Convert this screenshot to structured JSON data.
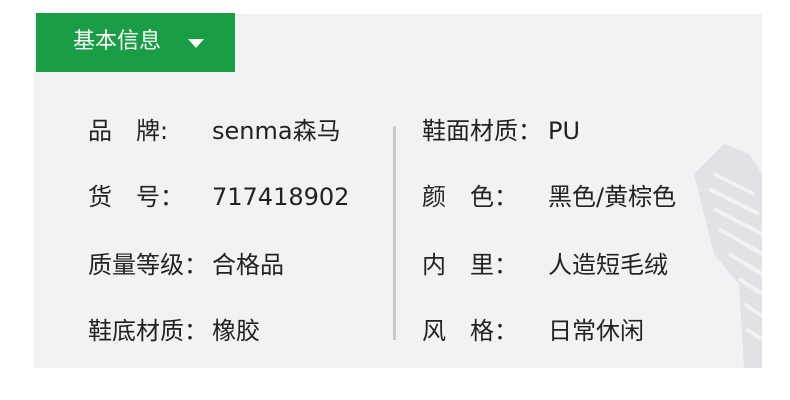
{
  "tab": {
    "label": "基本信息",
    "icon": "caret-down-icon"
  },
  "left": [
    {
      "key": "品　牌:",
      "value": "senma森马"
    },
    {
      "key": "货　号：",
      "value": "717418902"
    },
    {
      "key": "质量等级：",
      "value": "合格品"
    },
    {
      "key": "鞋底材质：",
      "value": "橡胶"
    }
  ],
  "right": [
    {
      "key": "鞋面材质：",
      "value": "PU"
    },
    {
      "key": "颜　色：",
      "value": "黑色/黄棕色"
    },
    {
      "key": "内　里：",
      "value": "人造短毛绒"
    },
    {
      "key": "风　格：",
      "value": "日常休闲"
    }
  ],
  "colors": {
    "accent": "#1a9e45",
    "panel": "#f2f1f4",
    "text": "#222222"
  }
}
